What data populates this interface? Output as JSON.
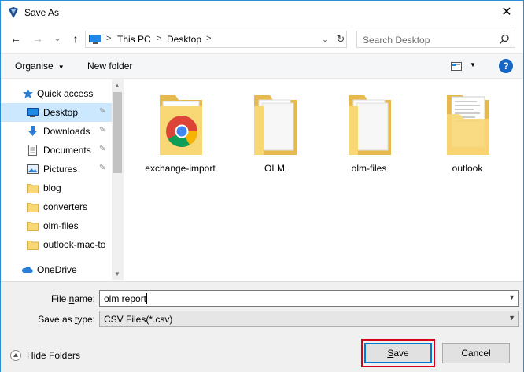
{
  "window": {
    "title": "Save As",
    "close_glyph": "✕"
  },
  "nav": {
    "back_glyph": "←",
    "forward_glyph": "→",
    "recent_glyph": "⌄",
    "up_glyph": "↑",
    "breadcrumbs": [
      "This PC",
      "Desktop"
    ],
    "crumb_sep": ">",
    "dropdown_glyph": "⌄",
    "refresh_glyph": "↻"
  },
  "search": {
    "placeholder": "Search Desktop"
  },
  "commands": {
    "organise": "Organise",
    "new_folder": "New folder",
    "help": "?"
  },
  "sidebar": {
    "items": [
      {
        "label": "Quick access",
        "icon": "star-icon"
      },
      {
        "label": "Desktop",
        "icon": "desktop-icon",
        "pinned": true,
        "selected": true
      },
      {
        "label": "Downloads",
        "icon": "download-icon",
        "pinned": true
      },
      {
        "label": "Documents",
        "icon": "documents-icon",
        "pinned": true
      },
      {
        "label": "Pictures",
        "icon": "pictures-icon",
        "pinned": true
      },
      {
        "label": "blog",
        "icon": "folder-icon"
      },
      {
        "label": "converters",
        "icon": "folder-icon"
      },
      {
        "label": "olm-files",
        "icon": "folder-icon"
      },
      {
        "label": "outlook-mac-to",
        "icon": "folder-icon"
      },
      {
        "label": "OneDrive",
        "icon": "cloud-icon"
      }
    ],
    "pin_glyph": "📌"
  },
  "files": [
    {
      "name": "exchange-import",
      "icon": "folder-chrome-icon"
    },
    {
      "name": "OLM",
      "icon": "folder-icon"
    },
    {
      "name": "olm-files",
      "icon": "folder-icon"
    },
    {
      "name": "outlook",
      "icon": "folder-document-icon"
    }
  ],
  "form": {
    "file_name_label_prefix": "File ",
    "file_name_label_key": "n",
    "file_name_label_suffix": "ame:",
    "file_name_value": "olm report",
    "save_type_label_prefix": "Save as ",
    "save_type_label_key": "t",
    "save_type_label_suffix": "ype:",
    "save_type_value": "CSV Files(*.csv)"
  },
  "footer": {
    "hide_folders": "Hide Folders",
    "save_key": "S",
    "save_rest": "ave",
    "cancel": "Cancel"
  },
  "colors": {
    "accent": "#0078d7",
    "selection": "#cce8ff",
    "highlight_border": "#d9001c",
    "folder": "#f8d775"
  }
}
